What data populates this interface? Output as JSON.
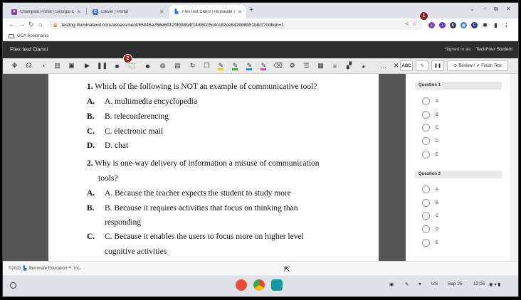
{
  "browser": {
    "tabs": [
      {
        "label": "Champion Portal | Georgia Cybe",
        "active": false
      },
      {
        "label": "Clever | Portal",
        "active": false
      },
      {
        "label": "Flex test Danni | Illuminate Onli",
        "active": true
      }
    ],
    "new_tab": "+",
    "url": "testing.illuminateed.com/assessment/65046a766e6912f9098b4f14/650c5c4cc82ce8420b8b51b8/1?rldbqn=1",
    "bookmarks": [
      {
        "label": "GCA Bookmarks"
      }
    ],
    "annotation_badges": [
      "1",
      "2"
    ]
  },
  "app": {
    "title": "Flex test Danni",
    "signed_in_label": "Signed in as:",
    "user": "TechFour Student"
  },
  "reading_toolbar": {
    "abc_label": "ABC",
    "review_label": "Review /",
    "finish_label": "Finish Test",
    "more_label": "…",
    "close_label": "✕"
  },
  "document": {
    "questions": [
      {
        "number": "1.",
        "text": "Which of the following is NOT an example of communicative tool?",
        "options": [
          {
            "letter": "A.",
            "text": "A. multimedia encyclopedia"
          },
          {
            "letter": "B.",
            "text": "B. teleconferencing"
          },
          {
            "letter": "C.",
            "text": "C. electronic mail"
          },
          {
            "letter": "D.",
            "text": "D. chat"
          }
        ]
      },
      {
        "number": "2.",
        "text_line1": "Why is one-way delivery of information a misuse of communication",
        "text_line2": "tools?",
        "options": [
          {
            "letter": "A.",
            "text": "A. Because the teacher expects the student to study more"
          },
          {
            "letter": "B.",
            "text_line1": "B. Because it requires activities that focus on thinking than",
            "text_line2": "responding"
          },
          {
            "letter": "C.",
            "text_line1": "C. Because it enables the users to focus more on higher level",
            "text_line2": "cognitive activities"
          }
        ]
      }
    ]
  },
  "answer_panel": {
    "questions": [
      {
        "label": "Question 1",
        "choices": [
          "A",
          "B",
          "C",
          "D",
          "E"
        ]
      },
      {
        "label": "Question 2",
        "choices": [
          "A",
          "B",
          "C",
          "D",
          "E"
        ]
      }
    ]
  },
  "footer": {
    "copyright": "©2023",
    "company": "Illuminate Education™, Inc."
  },
  "shelf": {
    "language": "US",
    "date": "Sep 25",
    "time": "12:05"
  },
  "colors": {
    "header_bg": "#2d2d2d",
    "badge": "#9b1c1c",
    "gutter": "#555555"
  }
}
